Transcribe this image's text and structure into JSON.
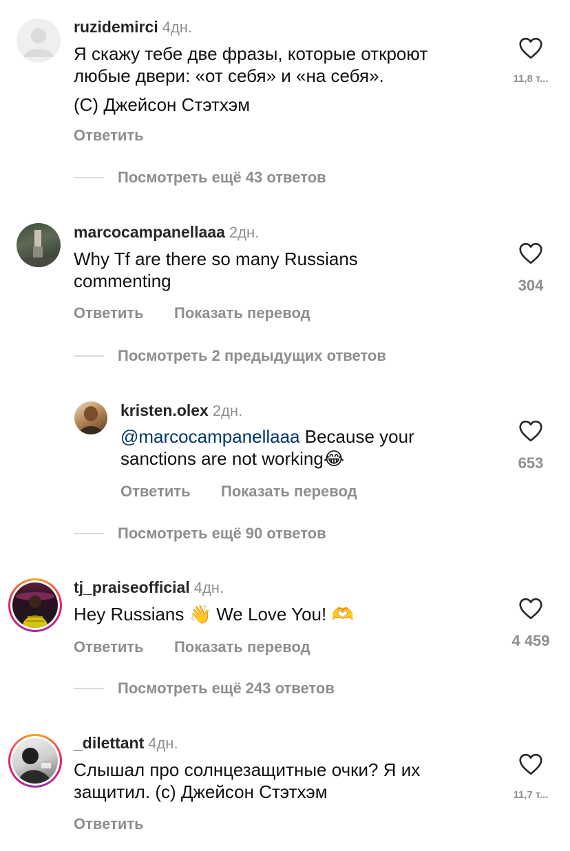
{
  "comments": [
    {
      "username": "ruzidemirci",
      "time": "4дн.",
      "text_line1": "Я скажу тебе две фразы, которые откроют",
      "text_line2": "любые двери: «от себя» и «на себя».",
      "text_line3": "(С) Джейсон Стэтхэм",
      "likes": "11,8 т...",
      "reply_label": "Ответить",
      "more_replies": "Посмотреть ещё 43 ответов"
    },
    {
      "username": "marcocampanellaaa",
      "time": "2дн.",
      "text_line1": "Why Tf are there so many Russians",
      "text_line2": "commenting",
      "likes": "304",
      "reply_label": "Ответить",
      "translate_label": "Показать перевод",
      "prev_replies": "Посмотреть 2 предыдущих ответов"
    },
    {
      "username": "kristen.olex",
      "time": "2дн.",
      "mention": "@marcocampanellaaa",
      "text_line1_rest": " Because your",
      "text_line2": "sanctions are not working",
      "emoji": "😂",
      "likes": "653",
      "reply_label": "Ответить",
      "translate_label": "Показать перевод",
      "more_replies": "Посмотреть ещё 90 ответов"
    },
    {
      "username": "tj_praiseofficial",
      "time": "4дн.",
      "text_a": "Hey Russians ",
      "emoji_wave": "👋",
      "text_b": " We Love You! ",
      "emoji_heart_hands": "🫶",
      "likes": "4 459",
      "reply_label": "Ответить",
      "translate_label": "Показать перевод",
      "more_replies": "Посмотреть ещё 243 ответов"
    },
    {
      "username": "_dilettant",
      "time": "4дн.",
      "text_line1": "Слышал про солнцезащитные очки? Я их",
      "text_line2": "защитил. (с) Джейсон Стэтхэм",
      "likes": "11,7 т...",
      "reply_label": "Ответить"
    }
  ],
  "icons": {
    "like": "heart-outline-icon",
    "avatar_placeholder": "default-avatar-icon"
  },
  "colors": {
    "secondary_text": "#8e8e8e",
    "mention": "#00376b",
    "divider": "#dbdbdb"
  }
}
